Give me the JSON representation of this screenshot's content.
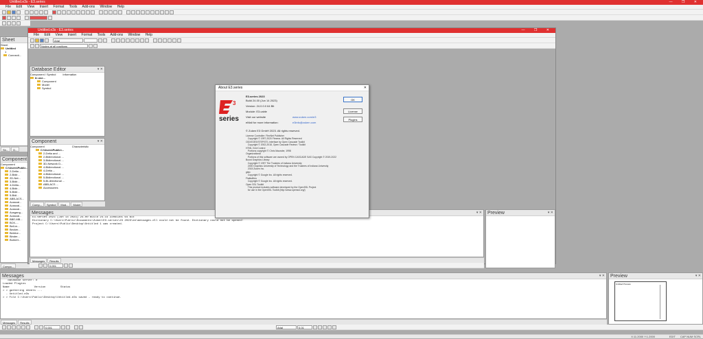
{
  "app": {
    "title": "Untitled.e3s - E3.series",
    "menu": [
      "File",
      "Edit",
      "View",
      "Insert",
      "Format",
      "Tools",
      "Add-ons",
      "Window",
      "Help"
    ],
    "window_controls": [
      "—",
      "❐",
      "✕"
    ]
  },
  "child": {
    "title": "Untitled.e3s - E3.series",
    "menu": [
      "File",
      "Edit",
      "View",
      "Insert",
      "Format",
      "Tools",
      "Add-ons",
      "Window",
      "Help"
    ],
    "font_combo": "Arial",
    "filter_combo": "Nodes at all positions",
    "zoom_value": "0.001"
  },
  "sheet_panel": {
    "title": "Sheet",
    "subtitle": "Sheet",
    "items": [
      "Untitled",
      "1",
      "Connecti..."
    ]
  },
  "database_panel": {
    "title": "Database Editor",
    "col1": "Component / Symbol",
    "col2": "Information",
    "items": [
      "In use...",
      "Component",
      "Model",
      "Symbol"
    ],
    "tabs": [
      "Sh...",
      "D..."
    ]
  },
  "component_panel_inner": {
    "title": "Component",
    "col1": "Component",
    "col2": "Characteristic",
    "root": "C:\\Users\\Public\\...",
    "items": [
      "2-Delta and ...",
      "2-Bidirectional ...",
      "3-Bidirectional ...",
      "3D-Network D...",
      "4-Bidirectional ...",
      "4-Delta ...",
      "4-Bidirectional ...",
      "5-Bidirectional ...",
      "5-Bi-directional ...",
      "ABB-ACS ...",
      "Accessories"
    ],
    "tabs": [
      "Comp...",
      "Symbol",
      "Mod...",
      "Model"
    ]
  },
  "component_panel_outer": {
    "title": "Component",
    "col1": "Component",
    "root": "C:\\Users\\Public...",
    "items": [
      "2-Delta ...",
      "2-Bidir...",
      "2D-Net...",
      "3-Bidir...",
      "4-Delta...",
      "4-Bidir...",
      "5-Bidir...",
      "5-Bidi...",
      "ABB-ACS...",
      "Avanzal...",
      "Avanzal...",
      "Avanzal...",
      "Ausgang...",
      "Avanzal...",
      "BBE-MB...",
      "BCK-...",
      "Bell-m...",
      "Becker...",
      "Berktor...",
      "Binder...",
      "Burkert..."
    ],
    "tabs": [
      "Compo...",
      "Shee..."
    ]
  },
  "messages_inner": {
    "title": "Messages",
    "lines": [
      "E3.series 2023 (Jun 14 2023) 24.00 Build 24.14 22061301 64 Bit",
      "Dictionary C:\\Users\\Public\\Documents\\Zuken\\E3.series\\23 2023\\en\\messages.dll could not be found. Dictionary could not be opened!",
      "Project C:\\Users\\Public\\Desktop\\Untitled 1 was created."
    ],
    "tabs": [
      "Messages",
      "Results"
    ],
    "zoom": "0.001"
  },
  "preview_inner": {
    "title": "Preview"
  },
  "messages_outer": {
    "title": "Messages",
    "lines": [
      "   database server: 0",
      "",
      "Loaded Plugins",
      "Name               Version         Status",
      "",
      "> > gathering sheets ...",
      "  - Untitled.e3s",
      "> > File C:\\Users\\Public\\Desktop\\Untitled.e3s saved - ready to continue."
    ],
    "tabs": [
      "Messages",
      "Results"
    ],
    "zoom": "0.001",
    "font": "Arial",
    "size": "0.01"
  },
  "preview_outer": {
    "title": "Preview",
    "inner_label": "Untitled Preview"
  },
  "status": {
    "coords": "X:11.2000   Y:1.2000",
    "mode": "EDIT",
    "ins": "CAP  NUM  SCRL"
  },
  "about": {
    "title": "About E3.series",
    "logo_text": "series",
    "product": "E3.series 2023",
    "build": "Build 24.00 (Jun 14 2023)",
    "version": "Version: 24.0.0.0 64 Bit",
    "module": "Module: E3.cable",
    "visit_label": "Visit our website",
    "visit_link": "www.zuken.com/e3",
    "email_label": "eMail for more information:",
    "email_link": "e3info@zuken.com",
    "copyright": "© Zuken E3 GmbH 2023. All rights reserved.",
    "credits": "License Controller: FlexNet Publisher\n   Copyright © 1997-2020 Flexera. All Rights Reserved\nODX/IGES/STEP/STL interface by Open Cascade Toolkit\n   Copyright © 2002-2018, Open Cascade Review / Toolkit\nHTML Grid Control\n   Portions copyright © Chris Maunder, 1998\nOrganizational\n   Portions of this software are owned by OPEN CASCADE SAS Copyright © 2019-2022\nBoost Graphics Library\n   Copyright © 1997 The Trustees of Indiana University\n   2000 Graphics University of Technology and the Trustees of Indiana University\n   2015 Zuken Inc.\nglslc\n   Copyright © Google Inc. All rights reserved.\nFlatbuffers\n   Copyright © Google Inc. All rights reserved.\nOpen SSL Toolkit\n   This product includes software developed by the OpenSSL Project\n   for use in the OpenSSL Toolkit (http://www.openssl.org/)",
    "buttons": {
      "ok": "OK",
      "license": "License",
      "plugins": "Plugins"
    }
  }
}
